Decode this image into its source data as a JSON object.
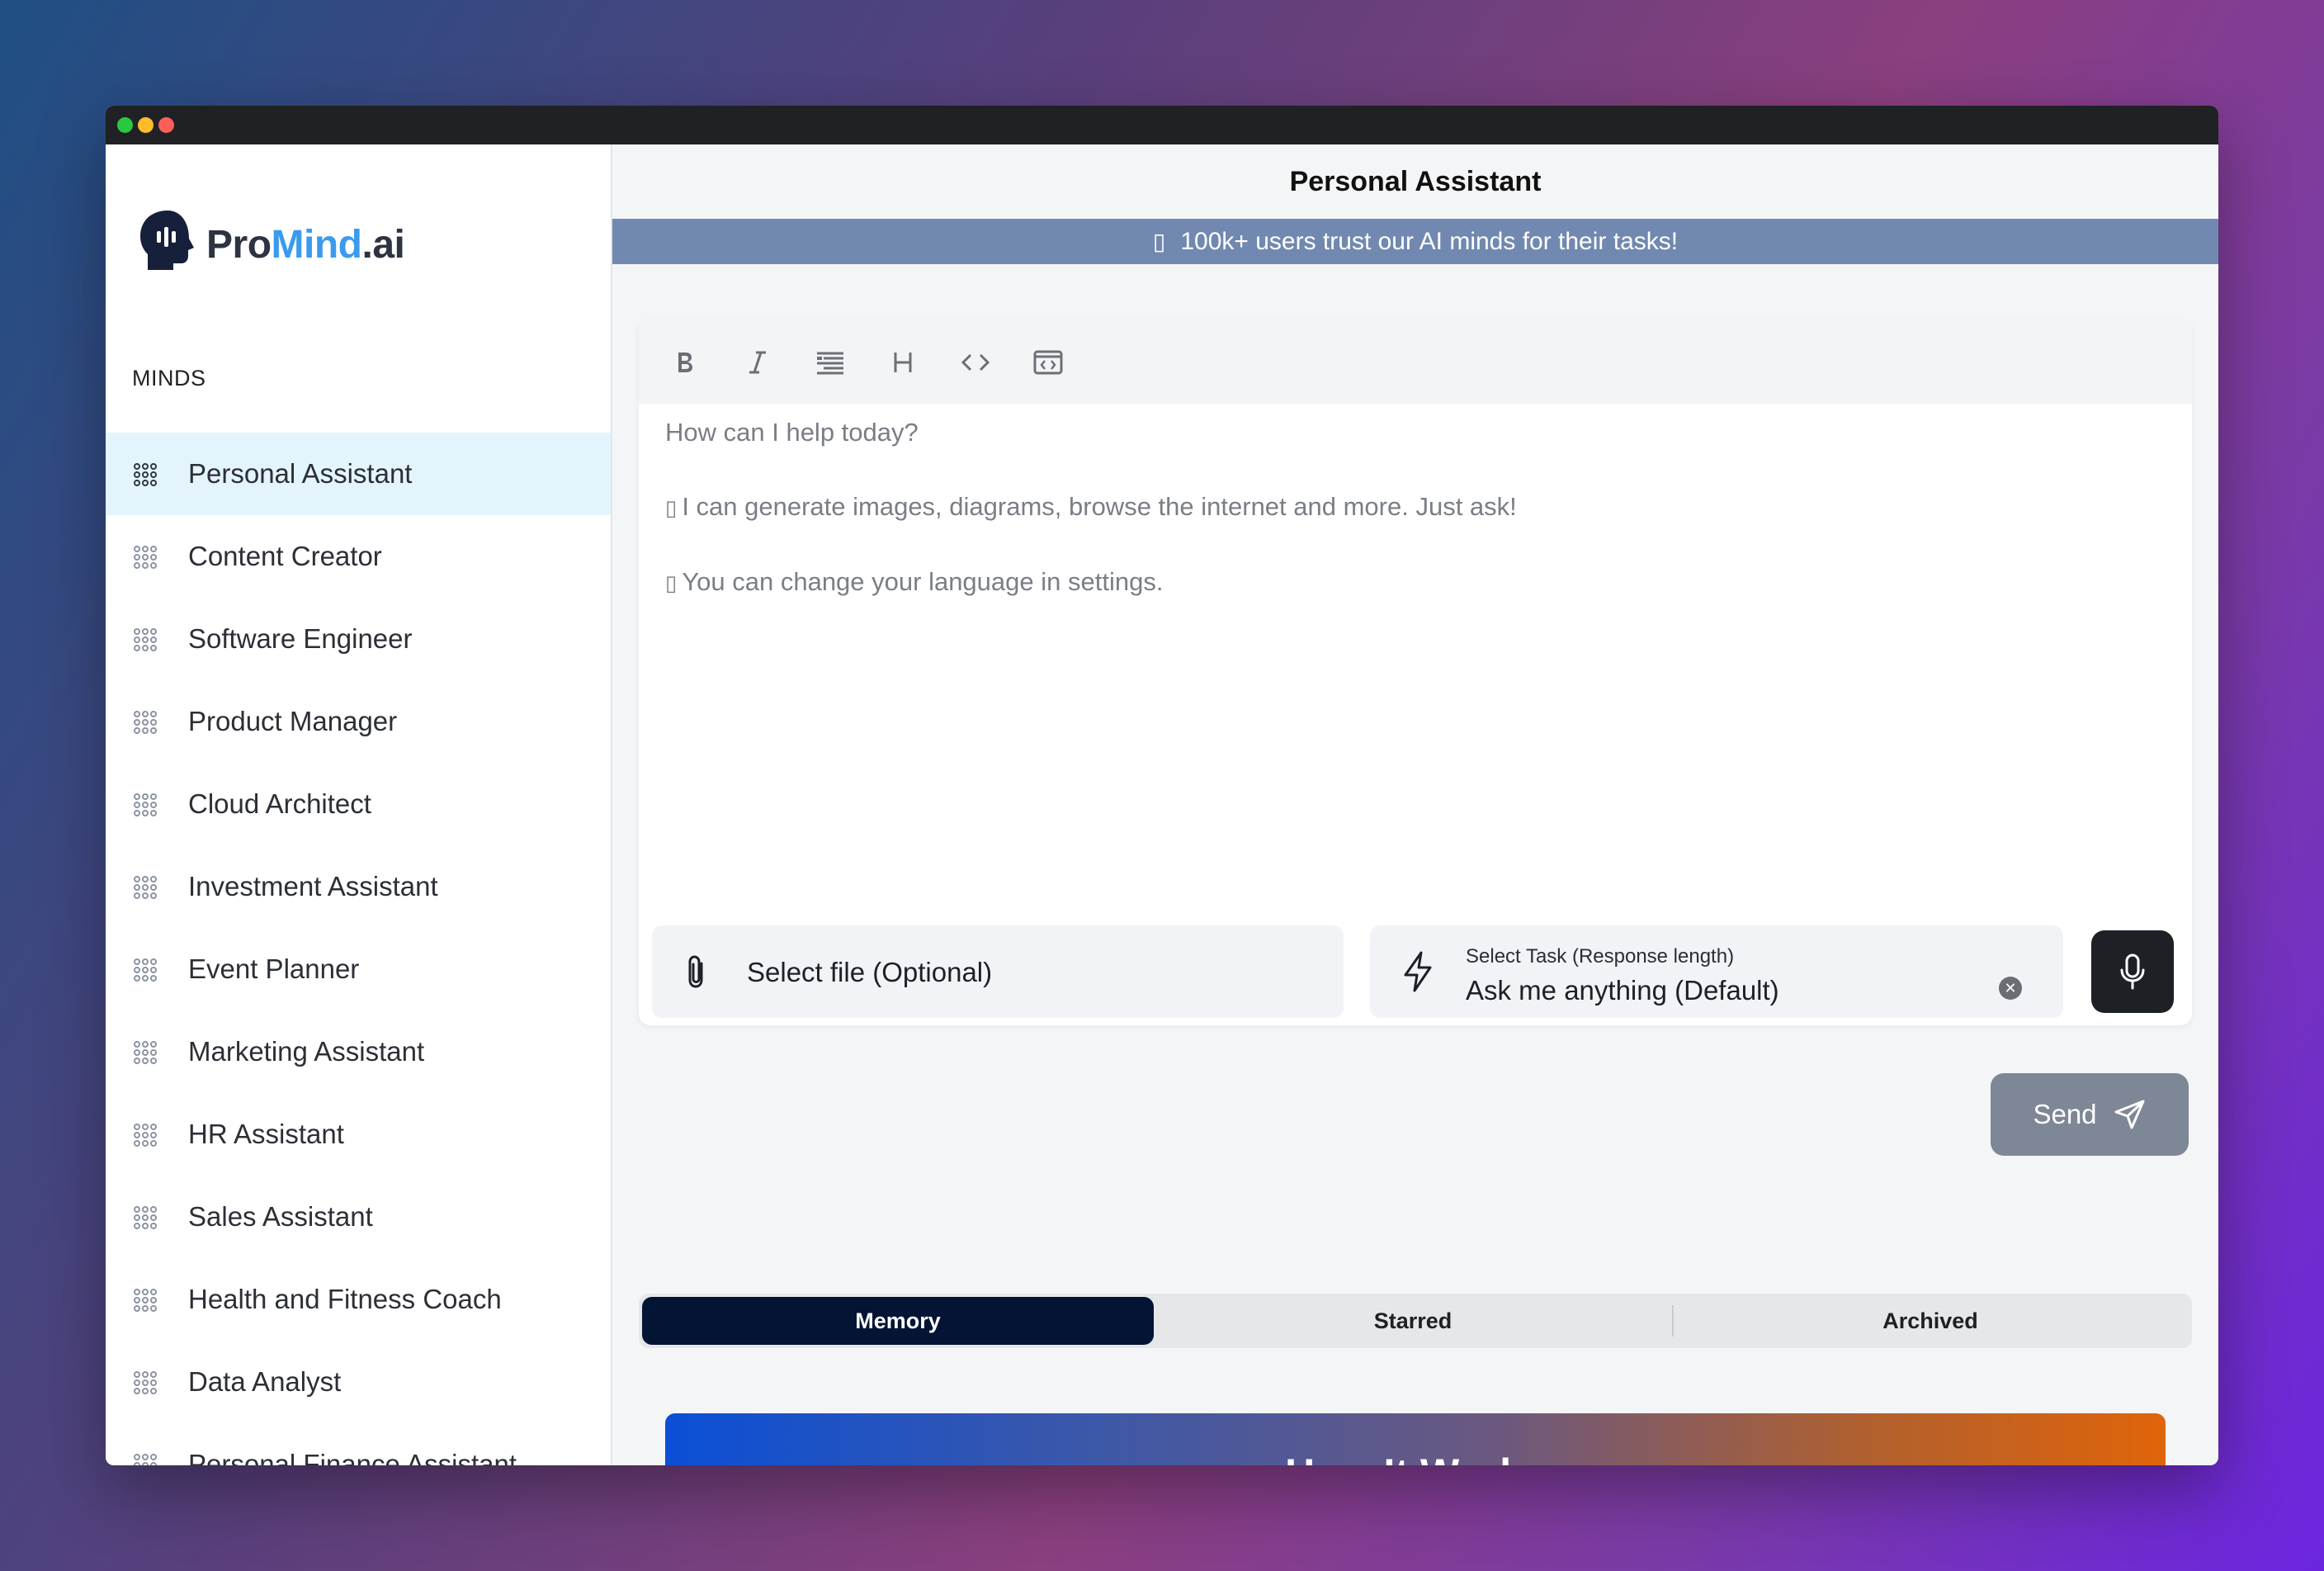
{
  "app": {
    "logo": {
      "part1": "Pro",
      "part2": "Mind",
      "part3": ".ai"
    },
    "accent_color": "#3a9bee"
  },
  "sidebar": {
    "section_title": "MINDS",
    "items": [
      {
        "label": "Personal Assistant",
        "active": true
      },
      {
        "label": "Content Creator"
      },
      {
        "label": "Software Engineer"
      },
      {
        "label": "Product Manager"
      },
      {
        "label": "Cloud Architect"
      },
      {
        "label": "Investment Assistant"
      },
      {
        "label": "Event Planner"
      },
      {
        "label": "Marketing Assistant"
      },
      {
        "label": "HR Assistant"
      },
      {
        "label": "Sales Assistant"
      },
      {
        "label": "Health and Fitness Coach"
      },
      {
        "label": "Data Analyst"
      },
      {
        "label": "Personal Finance Assistant"
      }
    ]
  },
  "main": {
    "title": "Personal Assistant",
    "banner": {
      "text": "100k+ users trust our AI minds for their tasks!"
    },
    "editor": {
      "toolbar": [
        "bold-icon",
        "italic-icon",
        "strikethrough-icon",
        "heading-icon",
        "code-icon",
        "code-block-icon"
      ],
      "placeholder_lines": [
        "How can I help today?",
        "I can generate images, diagrams, browse the internet and more. Just ask!",
        "You can change your language in settings."
      ]
    },
    "file_select": {
      "label": "Select file (Optional)"
    },
    "task_select": {
      "label": "Select Task (Response length)",
      "value": "Ask me anything (Default)"
    },
    "send_label": "Send",
    "tabs": [
      {
        "label": "Memory",
        "active": true
      },
      {
        "label": "Starred"
      },
      {
        "label": "Archived"
      }
    ],
    "how_it_works": "How It Works"
  }
}
